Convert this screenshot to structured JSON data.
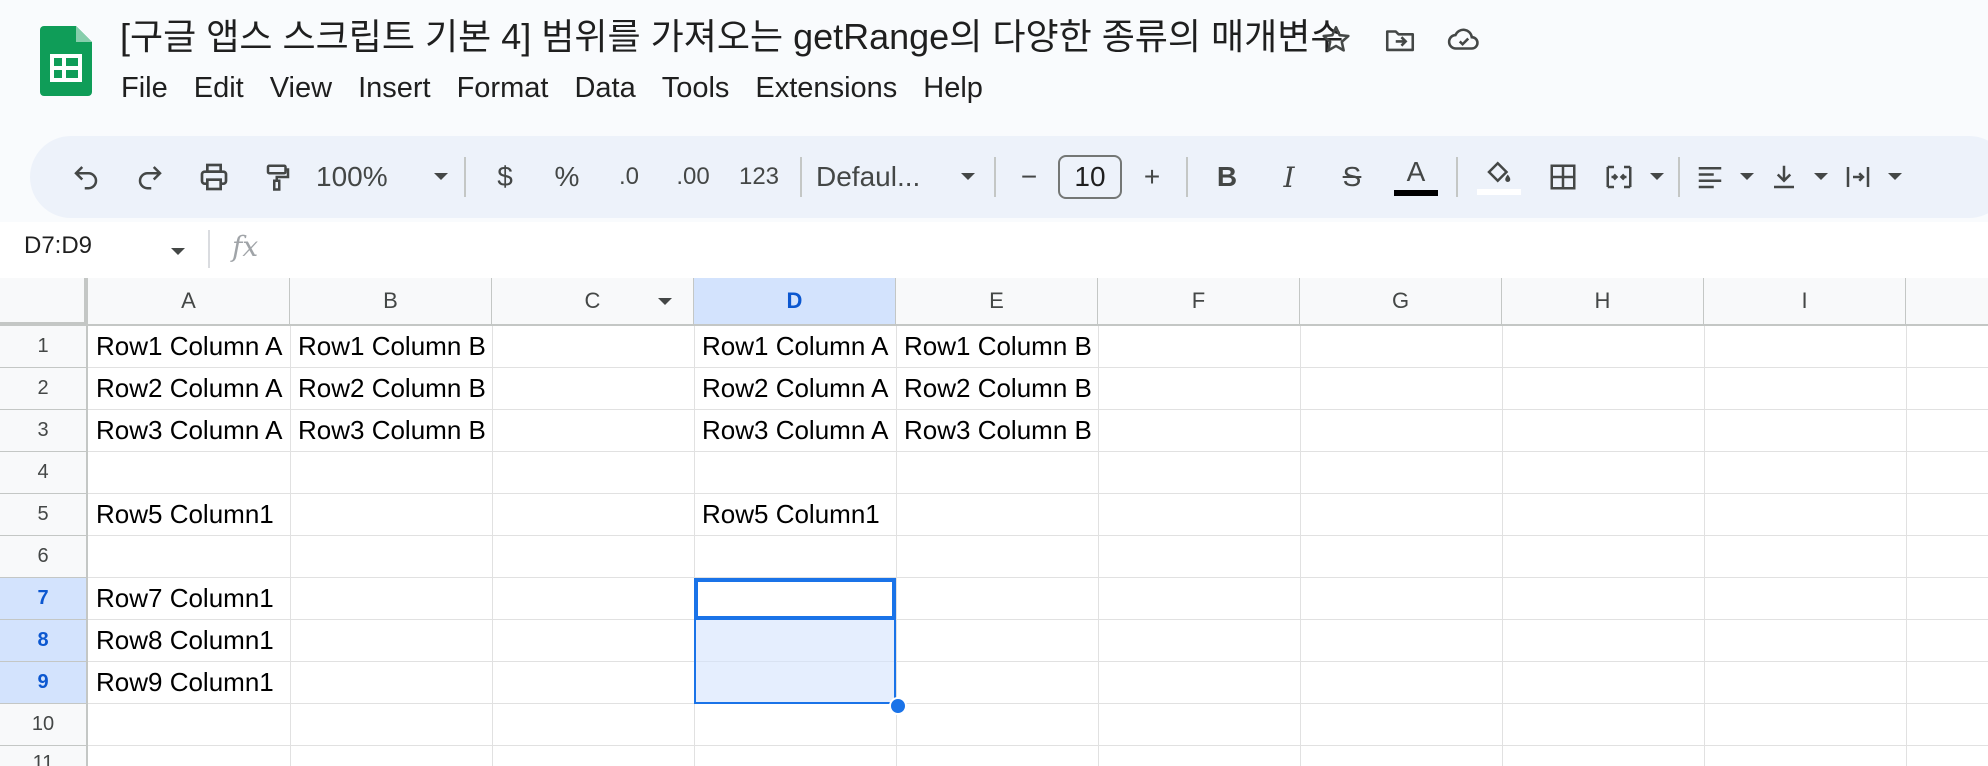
{
  "doc": {
    "title": "[구글 앱스 스크립트 기본 4] 범위를 가져오는 getRange의 다양한 종류의 매개변수",
    "logo_icon": "google-sheets-logo",
    "brand_color": "#0f9d58"
  },
  "title_icons": [
    "star-icon",
    "move-to-folder-icon",
    "cloud-saved-icon"
  ],
  "menu": [
    "File",
    "Edit",
    "View",
    "Insert",
    "Format",
    "Data",
    "Tools",
    "Extensions",
    "Help"
  ],
  "toolbar": {
    "zoom": "100%",
    "currency": "$",
    "percent": "%",
    "decrease_decimal": ".0",
    "increase_decimal": ".00",
    "number_format": "123",
    "font": "Defaul...",
    "font_size": "10",
    "minus": "−",
    "plus": "+",
    "bold": "B",
    "italic": "I",
    "strikethrough": "S",
    "text_color_label": "A",
    "text_color": "#000000",
    "fill_color": "#ffffff"
  },
  "formula_bar": {
    "name_box": "D7:D9",
    "fx": "fx",
    "content": ""
  },
  "sheet": {
    "columns": [
      "A",
      "B",
      "C",
      "D",
      "E",
      "F",
      "G",
      "H",
      "I"
    ],
    "selected_column": "D",
    "rows": [
      "1",
      "2",
      "3",
      "4",
      "5",
      "6",
      "7",
      "8",
      "9",
      "10",
      "11"
    ],
    "selected_rows": [
      "7",
      "8",
      "9"
    ],
    "selection_color": "#1a73e8",
    "cells": {
      "A1": "Row1 Column A",
      "B1": "Row1 Column B",
      "D1": "Row1 Column A",
      "E1": "Row1 Column B",
      "A2": "Row2 Column A",
      "B2": "Row2 Column B",
      "D2": "Row2 Column A",
      "E2": "Row2 Column B",
      "A3": "Row3 Column A",
      "B3": "Row3 Column B",
      "D3": "Row3 Column A",
      "E3": "Row3 Column B",
      "A5": "Row5 Column1",
      "D5": "Row5 Column1",
      "A7": "Row7 Column1",
      "A8": "Row8 Column1",
      "A9": "Row9 Column1"
    }
  }
}
